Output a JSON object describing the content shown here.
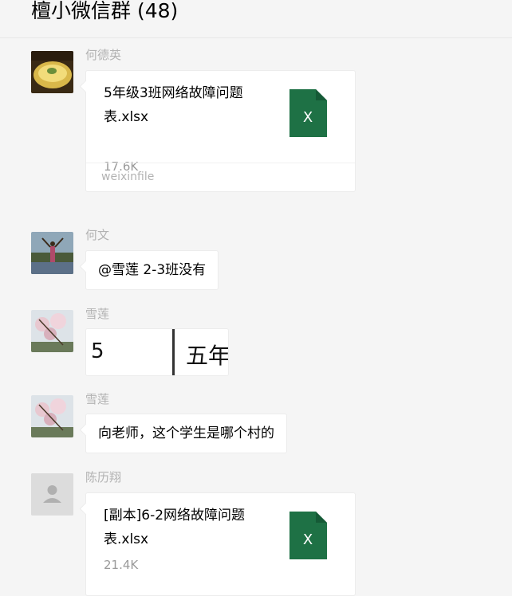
{
  "header": {
    "title": "檀小微信群 (48)"
  },
  "messages": [
    {
      "sender": "何德英",
      "type": "file",
      "file_name": "5年级3班网络故障问题表.xlsx",
      "file_size": "17.6K",
      "file_source": "weixinfile",
      "file_icon_letter": "X"
    },
    {
      "sender": "何文",
      "type": "text",
      "text": "@雪莲 2-3班没有"
    },
    {
      "sender": "雪莲",
      "type": "image",
      "img_cell1": "5",
      "img_cell2": "五年"
    },
    {
      "sender": "雪莲",
      "type": "text",
      "text": "向老师，这个学生是哪个村的"
    },
    {
      "sender": "陈历翔",
      "type": "file",
      "file_name": "[副本]6-2网络故障问题表.xlsx",
      "file_size": "21.4K",
      "file_icon_letter": "X"
    }
  ],
  "colors": {
    "excel_green": "#1e7145",
    "sender_gray": "#b2b2b2"
  }
}
